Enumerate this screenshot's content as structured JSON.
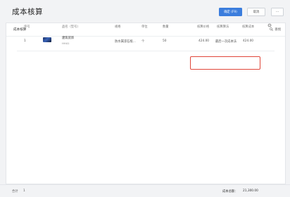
{
  "header": {
    "title": "成本核算",
    "confirm_label": "确定 (F9)",
    "cancel_label": "取消",
    "more_label": "···"
  },
  "card": {
    "title": "成本核算",
    "search_label": "查找",
    "search_icon": "search-icon"
  },
  "table": {
    "columns": [
      "序号",
      "品名（型号）",
      "规格",
      "单位",
      "数量",
      "核算价格",
      "核算算法",
      "核算成本"
    ],
    "settings_icon": "gear-icon",
    "rows": [
      {
        "index": "1",
        "name": "建筑装饰",
        "model": "HH41",
        "spec": "防水属漆石板...",
        "unit": "个",
        "qty": "50",
        "price": "424.00",
        "method": "最后一次成本法",
        "cost": "424.00"
      }
    ]
  },
  "footer": {
    "total_label": "合计",
    "total_count": "1",
    "cost_total_label": "成本总额：",
    "cost_total_value": "21,300.00"
  },
  "colors": {
    "accent": "#3b7ddd",
    "highlight_border": "#e0463a",
    "background": "#f2f3f5"
  }
}
